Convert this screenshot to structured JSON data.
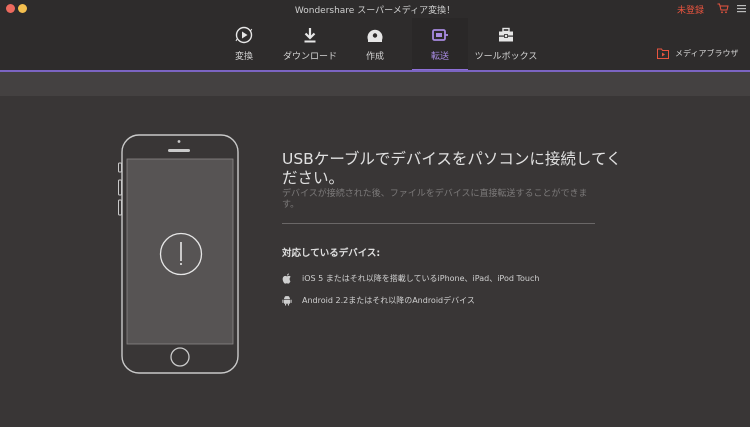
{
  "window": {
    "title": "Wondershare スーパーメディア変換！",
    "unregistered_label": "未登録"
  },
  "toolbar": {
    "tabs": [
      {
        "label": "変換",
        "icon": "convert-icon"
      },
      {
        "label": "ダウンロード",
        "icon": "download-icon"
      },
      {
        "label": "作成",
        "icon": "burn-disc-icon"
      },
      {
        "label": "転送",
        "icon": "transfer-icon",
        "active": true
      },
      {
        "label": "ツールボックス",
        "icon": "toolbox-icon"
      }
    ],
    "media_browser_label": "メディアブラウザ"
  },
  "main": {
    "heading": "USBケーブルでデバイスをパソコンに接続してください。",
    "subtext": "デバイスが接続された後、ファイルをデバイスに直接転送することができます。",
    "supported_title": "対応しているデバイス:",
    "devices": [
      {
        "label": "iOS 5 またはそれ以降を搭載しているiPhone、iPad、iPod Touch",
        "icon": "apple-icon"
      },
      {
        "label": "Android 2.2またはそれ以降のAndroidデバイス",
        "icon": "android-icon"
      }
    ]
  },
  "colors": {
    "accent": "#8d70d6",
    "background": "#393636",
    "toolbar": "#2e2c2c",
    "unregistered": "#e8543f"
  }
}
